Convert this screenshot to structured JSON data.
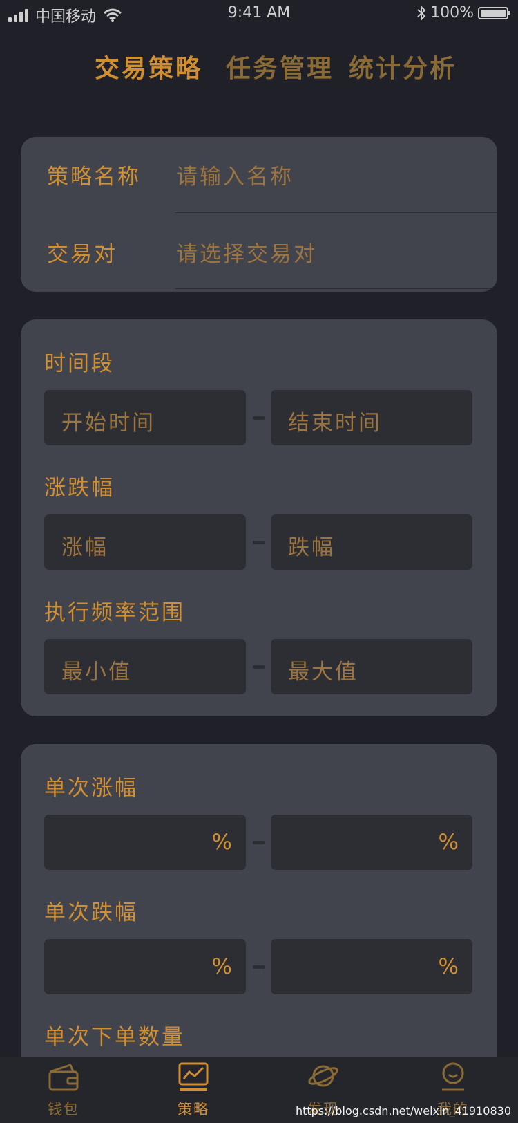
{
  "status_bar": {
    "carrier": "中国移动",
    "time": "9:41 AM",
    "battery": "100%"
  },
  "top_tabs": [
    {
      "label": "交易策略",
      "active": true
    },
    {
      "label": "任务管理",
      "active": false
    },
    {
      "label": "统计分析",
      "active": false
    }
  ],
  "basic": {
    "name_label": "策略名称",
    "name_placeholder": "请输入名称",
    "pair_label": "交易对",
    "pair_placeholder": "请选择交易对"
  },
  "range_card": {
    "time_label": "时间段",
    "time_start": "开始时间",
    "time_end": "结束时间",
    "change_label": "涨跌幅",
    "change_up": "涨幅",
    "change_down": "跌幅",
    "freq_label": "执行频率范围",
    "freq_min": "最小值",
    "freq_max": "最大值"
  },
  "single_card": {
    "rise_label": "单次涨幅",
    "fall_label": "单次跌幅",
    "qty_label": "单次下单数量",
    "unit": "%"
  },
  "tab_bar": [
    {
      "label": "钱包",
      "icon": "wallet-icon",
      "active": false
    },
    {
      "label": "策略",
      "icon": "chart-icon",
      "active": true
    },
    {
      "label": "发现",
      "icon": "planet-icon",
      "active": false
    },
    {
      "label": "我的",
      "icon": "user-icon",
      "active": false
    }
  ],
  "watermark": "https://blog.csdn.net/weixin_41910830",
  "colors": {
    "background": "#1f2028",
    "card": "#41444c",
    "input": "#2c2e33",
    "accent": "#d08f33",
    "muted_accent": "#8a6a35"
  }
}
